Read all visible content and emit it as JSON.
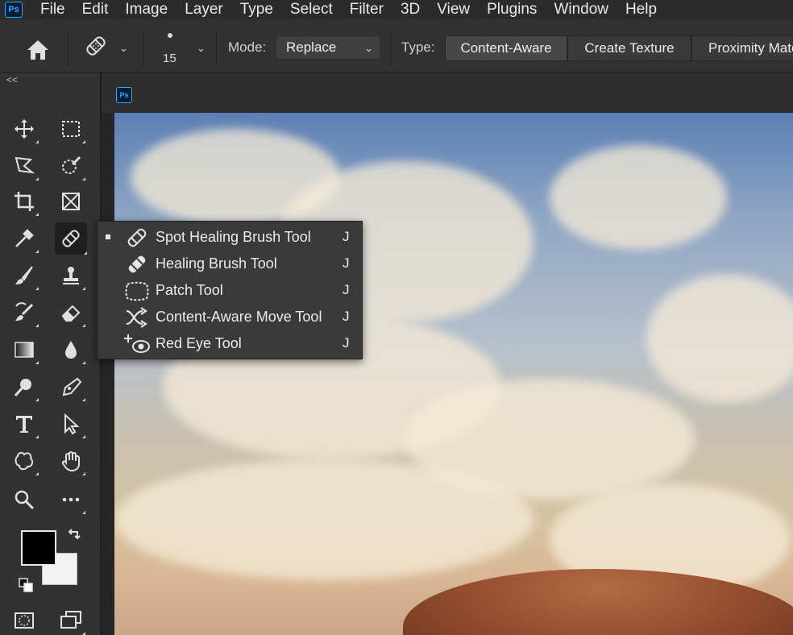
{
  "app": {
    "logo_text": "Ps"
  },
  "menubar": {
    "items": [
      {
        "label": "File",
        "x": 60
      },
      {
        "label": "Edit"
      },
      {
        "label": "Image"
      },
      {
        "label": "Layer"
      },
      {
        "label": "Type"
      },
      {
        "label": "Select"
      },
      {
        "label": "Filter"
      },
      {
        "label": "3D"
      },
      {
        "label": "View"
      },
      {
        "label": "Plugins"
      },
      {
        "label": "Window"
      },
      {
        "label": "Help"
      }
    ]
  },
  "options": {
    "brush_size": "15",
    "mode_label": "Mode:",
    "mode_value": "Replace",
    "type_label": "Type:",
    "type_buttons": [
      "Content-Aware",
      "Create Texture",
      "Proximity Matc"
    ]
  },
  "toolbar": {
    "collapse": "<<"
  },
  "document": {
    "tab_icon_text": "Ps"
  },
  "flyout": {
    "items": [
      {
        "label": "Spot Healing Brush Tool",
        "key": "J",
        "selected": true,
        "icon": "spot-healing-brush-icon"
      },
      {
        "label": "Healing Brush Tool",
        "key": "J",
        "selected": false,
        "icon": "healing-brush-icon"
      },
      {
        "label": "Patch Tool",
        "key": "J",
        "selected": false,
        "icon": "patch-icon"
      },
      {
        "label": "Content-Aware Move Tool",
        "key": "J",
        "selected": false,
        "icon": "content-aware-move-icon"
      },
      {
        "label": "Red Eye Tool",
        "key": "J",
        "selected": false,
        "icon": "red-eye-icon"
      }
    ]
  },
  "colors": {
    "foreground": "#000000",
    "background": "#f2f2f2",
    "ui_panel": "#323232"
  }
}
